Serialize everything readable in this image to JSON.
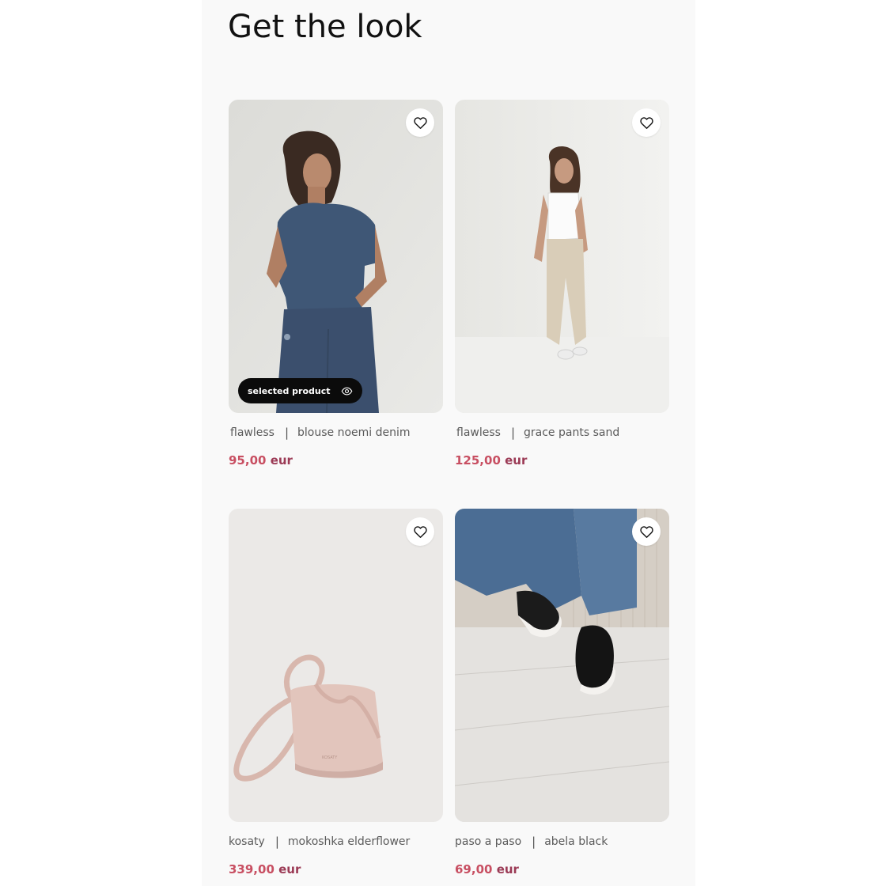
{
  "page": {
    "title": "Get the look"
  },
  "products": [
    {
      "brand": "flawless",
      "name": "blouse noemi denim",
      "price": "95,00",
      "currency": "eur",
      "selected_label": "selected product",
      "favorite_icon": "heart-outline-icon"
    },
    {
      "brand": "flawless",
      "name": "grace pants sand",
      "price": "125,00",
      "currency": "eur",
      "favorite_icon": "heart-outline-icon"
    },
    {
      "brand": "kosaty",
      "name": "mokoshka elderflower",
      "price": "339,00",
      "currency": "eur",
      "favorite_icon": "heart-outline-icon"
    },
    {
      "brand": "paso a paso",
      "name": "abela black",
      "price": "69,00",
      "currency": "eur",
      "favorite_icon": "heart-outline-icon"
    }
  ],
  "colors": {
    "price_amount": "#c84f62",
    "price_currency": "#9b3a55",
    "selected_pill_bg": "#0b0b0b",
    "panel_bg": "#f9f9f9"
  }
}
